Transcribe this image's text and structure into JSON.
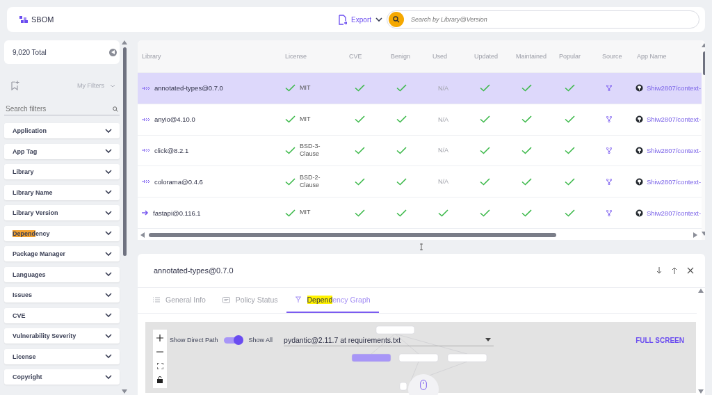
{
  "header": {
    "title": "SBOM",
    "export_label": "Export",
    "search_placeholder": "Search by Library@Version"
  },
  "sidebar": {
    "total": "9,020 Total",
    "my_filters": "My Filters",
    "search_placeholder": "Search filters",
    "filters": [
      {
        "label": "Application"
      },
      {
        "label": "App Tag"
      },
      {
        "label": "Library"
      },
      {
        "label": "Library Name"
      },
      {
        "label": "Library Version"
      },
      {
        "match": "Depend",
        "label": "ency"
      },
      {
        "label": "Package Manager"
      },
      {
        "label": "Languages"
      },
      {
        "label": "Issues"
      },
      {
        "label": "CVE"
      },
      {
        "label": "Vulnerability Severity"
      },
      {
        "label": "License"
      },
      {
        "label": "Copyright"
      }
    ]
  },
  "table": {
    "columns": [
      "Library",
      "License",
      "CVE",
      "Benign",
      "Used",
      "Updated",
      "Maintained",
      "Popular",
      "Source",
      "App Name"
    ],
    "rows": [
      {
        "library": "annotated-types@0.7.0",
        "kind": "transitive",
        "license": "MIT",
        "license_ok": true,
        "cells": [
          {
            "kind": "check"
          },
          {
            "kind": "check"
          },
          {
            "kind": "text",
            "text": "N/A"
          },
          {
            "kind": "check"
          },
          {
            "kind": "check"
          },
          {
            "kind": "check"
          }
        ],
        "app_name": "Shiw2807/context-",
        "selected": true
      },
      {
        "library": "anyio@4.10.0",
        "kind": "transitive",
        "license": "MIT",
        "license_ok": true,
        "cells": [
          {
            "kind": "check"
          },
          {
            "kind": "check"
          },
          {
            "kind": "text",
            "text": "N/A"
          },
          {
            "kind": "check"
          },
          {
            "kind": "check"
          },
          {
            "kind": "check"
          }
        ],
        "app_name": "Shiw2807/context-",
        "selected": false
      },
      {
        "library": "click@8.2.1",
        "kind": "transitive",
        "license": "BSD-3-Clause",
        "license_ok": true,
        "cells": [
          {
            "kind": "check"
          },
          {
            "kind": "check"
          },
          {
            "kind": "text",
            "text": "N/A"
          },
          {
            "kind": "check"
          },
          {
            "kind": "check"
          },
          {
            "kind": "check"
          }
        ],
        "app_name": "Shiw2807/context-",
        "selected": false
      },
      {
        "library": "colorama@0.4.6",
        "kind": "transitive",
        "license": "BSD-2-Clause",
        "license_ok": true,
        "cells": [
          {
            "kind": "check"
          },
          {
            "kind": "check"
          },
          {
            "kind": "text",
            "text": "N/A"
          },
          {
            "kind": "check"
          },
          {
            "kind": "check"
          },
          {
            "kind": "check"
          }
        ],
        "app_name": "Shiw2807/context-",
        "selected": false
      },
      {
        "library": "fastapi@0.116.1",
        "kind": "direct",
        "license": "MIT",
        "license_ok": true,
        "cells": [
          {
            "kind": "check"
          },
          {
            "kind": "check"
          },
          {
            "kind": "check"
          },
          {
            "kind": "check"
          },
          {
            "kind": "check"
          },
          {
            "kind": "check"
          }
        ],
        "app_name": "Shiw2807/context-",
        "selected": false
      }
    ]
  },
  "detail": {
    "title": "annotated-types@0.7.0",
    "tabs": [
      {
        "kind": "list",
        "label": "General Info",
        "selected": false
      },
      {
        "kind": "card",
        "label": "Policy Status",
        "selected": false
      },
      {
        "kind": "graph",
        "match": "Depend",
        "label": "ency Graph",
        "selected": true
      }
    ],
    "graph": {
      "direct_path_label": "Show Direct Path",
      "show_all_on": true,
      "show_all_label": "Show All",
      "root_value": "pydantic@2.11.7 at requirements.txt",
      "full_screen": "FULL SCREEN"
    }
  }
}
